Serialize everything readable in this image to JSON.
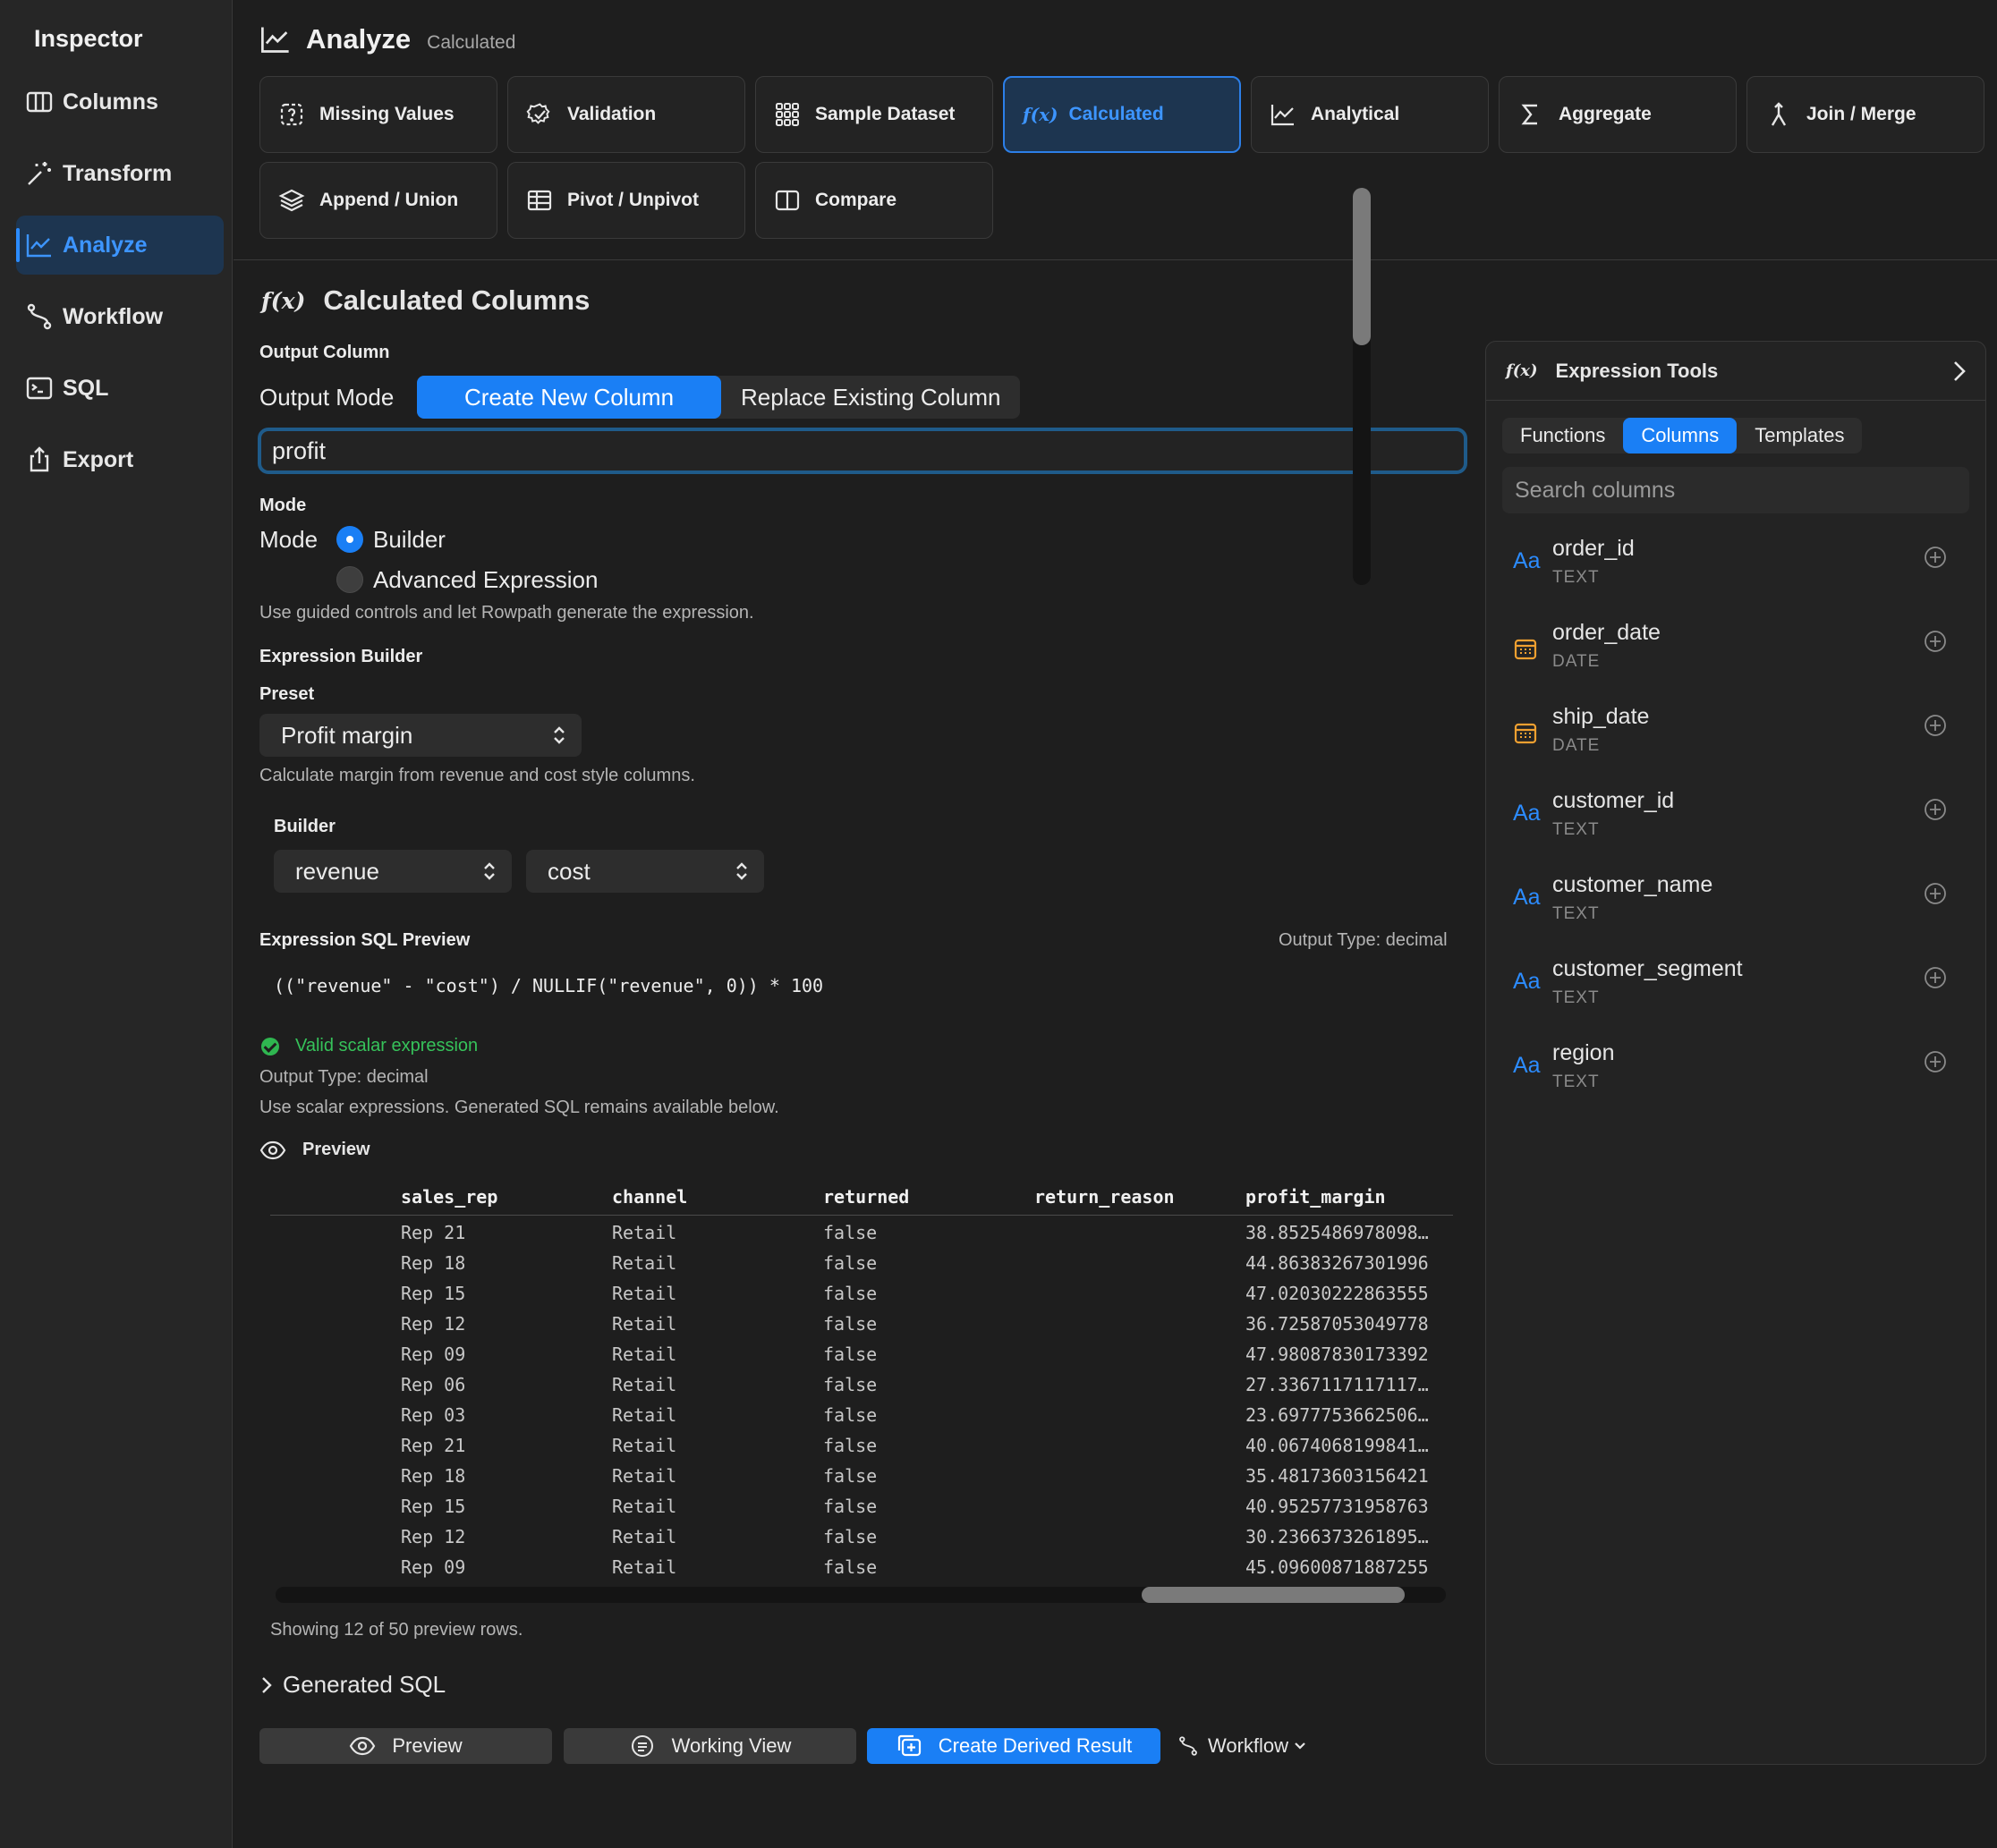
{
  "sidebar": {
    "title": "Inspector",
    "items": [
      {
        "label": "Columns",
        "icon": "columns-icon"
      },
      {
        "label": "Transform",
        "icon": "wand-icon"
      },
      {
        "label": "Analyze",
        "icon": "chart-line-icon",
        "active": true
      },
      {
        "label": "Workflow",
        "icon": "workflow-icon"
      },
      {
        "label": "SQL",
        "icon": "terminal-icon"
      },
      {
        "label": "Export",
        "icon": "share-icon"
      }
    ]
  },
  "header": {
    "title": "Analyze",
    "subtitle": "Calculated"
  },
  "tools": [
    {
      "label": "Missing Values",
      "icon": "missing-values-icon"
    },
    {
      "label": "Validation",
      "icon": "validation-badge-icon"
    },
    {
      "label": "Sample Dataset",
      "icon": "grid-dots-icon"
    },
    {
      "label": "Calculated",
      "icon": "function-icon",
      "active": true
    },
    {
      "label": "Analytical",
      "icon": "chart-line-icon"
    },
    {
      "label": "Aggregate",
      "icon": "sigma-icon"
    },
    {
      "label": "Join / Merge",
      "icon": "merge-icon"
    },
    {
      "label": "Append / Union",
      "icon": "layers-icon"
    },
    {
      "label": "Pivot / Unpivot",
      "icon": "table-icon"
    },
    {
      "label": "Compare",
      "icon": "split-view-icon"
    }
  ],
  "main": {
    "fx_glyph": "f(x)",
    "title": "Calculated Columns",
    "output_column_label": "Output Column",
    "output_mode_label": "Output Mode",
    "output_modes": [
      "Create New Column",
      "Replace Existing Column"
    ],
    "output_mode_selected": "Create New Column",
    "output_value": "profit",
    "mode_section_label": "Mode",
    "mode_label": "Mode",
    "mode_options": [
      "Builder",
      "Advanced Expression"
    ],
    "mode_selected": "Builder",
    "mode_hint": "Use guided controls and let Rowpath generate the expression.",
    "builder_section_label": "Expression Builder",
    "preset_label": "Preset",
    "preset_value": "Profit margin",
    "preset_hint": "Calculate margin from revenue and cost style columns.",
    "builder_label": "Builder",
    "builder_left": "revenue",
    "builder_right": "cost",
    "sql_preview_label": "Expression SQL Preview",
    "output_type_right": "Output Type: decimal",
    "sql": "((\"revenue\" - \"cost\") / NULLIF(\"revenue\", 0)) * 100",
    "valid_text": "Valid scalar expression",
    "output_type": "Output Type: decimal",
    "scalar_hint": "Use scalar expressions. Generated SQL remains available below.",
    "preview_label": "Preview",
    "showing": "Showing 12 of 50 preview rows.",
    "generated_sql": "Generated SQL",
    "buttons": {
      "preview": "Preview",
      "working_view": "Working View",
      "create_derived": "Create Derived Result",
      "workflow": "Workflow"
    }
  },
  "table": {
    "columns": [
      "sales_rep",
      "channel",
      "returned",
      "return_reason",
      "profit_margin"
    ],
    "rows": [
      [
        "Rep 21",
        "Retail",
        "false",
        "",
        "38.8525486978098…"
      ],
      [
        "Rep 18",
        "Retail",
        "false",
        "",
        "44.86383267301996"
      ],
      [
        "Rep 15",
        "Retail",
        "false",
        "",
        "47.02030222863555"
      ],
      [
        "Rep 12",
        "Retail",
        "false",
        "",
        "36.72587053049778"
      ],
      [
        "Rep 09",
        "Retail",
        "false",
        "",
        "47.98087830173392"
      ],
      [
        "Rep 06",
        "Retail",
        "false",
        "",
        "27.3367117117117…"
      ],
      [
        "Rep 03",
        "Retail",
        "false",
        "",
        "23.6977753662506…"
      ],
      [
        "Rep 21",
        "Retail",
        "false",
        "",
        "40.0674068199841…"
      ],
      [
        "Rep 18",
        "Retail",
        "false",
        "",
        "35.48173603156421"
      ],
      [
        "Rep 15",
        "Retail",
        "false",
        "",
        "40.95257731958763"
      ],
      [
        "Rep 12",
        "Retail",
        "false",
        "",
        "30.2366373261895…"
      ],
      [
        "Rep 09",
        "Retail",
        "false",
        "",
        "45.09600871887255"
      ]
    ]
  },
  "tools_panel": {
    "fx_glyph": "f(x)",
    "title": "Expression Tools",
    "tabs": [
      "Functions",
      "Columns",
      "Templates"
    ],
    "active_tab": "Columns",
    "search_placeholder": "Search columns",
    "columns": [
      {
        "name": "order_id",
        "type": "TEXT",
        "icon": "text-type-icon"
      },
      {
        "name": "order_date",
        "type": "DATE",
        "icon": "calendar-icon"
      },
      {
        "name": "ship_date",
        "type": "DATE",
        "icon": "calendar-icon"
      },
      {
        "name": "customer_id",
        "type": "TEXT",
        "icon": "text-type-icon"
      },
      {
        "name": "customer_name",
        "type": "TEXT",
        "icon": "text-type-icon"
      },
      {
        "name": "customer_segment",
        "type": "TEXT",
        "icon": "text-type-icon"
      },
      {
        "name": "region",
        "type": "TEXT",
        "icon": "text-type-icon"
      }
    ]
  },
  "colors": {
    "accent": "#1a7ff5",
    "active_bg": "#1d3550",
    "valid": "#36c25a",
    "date_icon": "#f0a030"
  }
}
